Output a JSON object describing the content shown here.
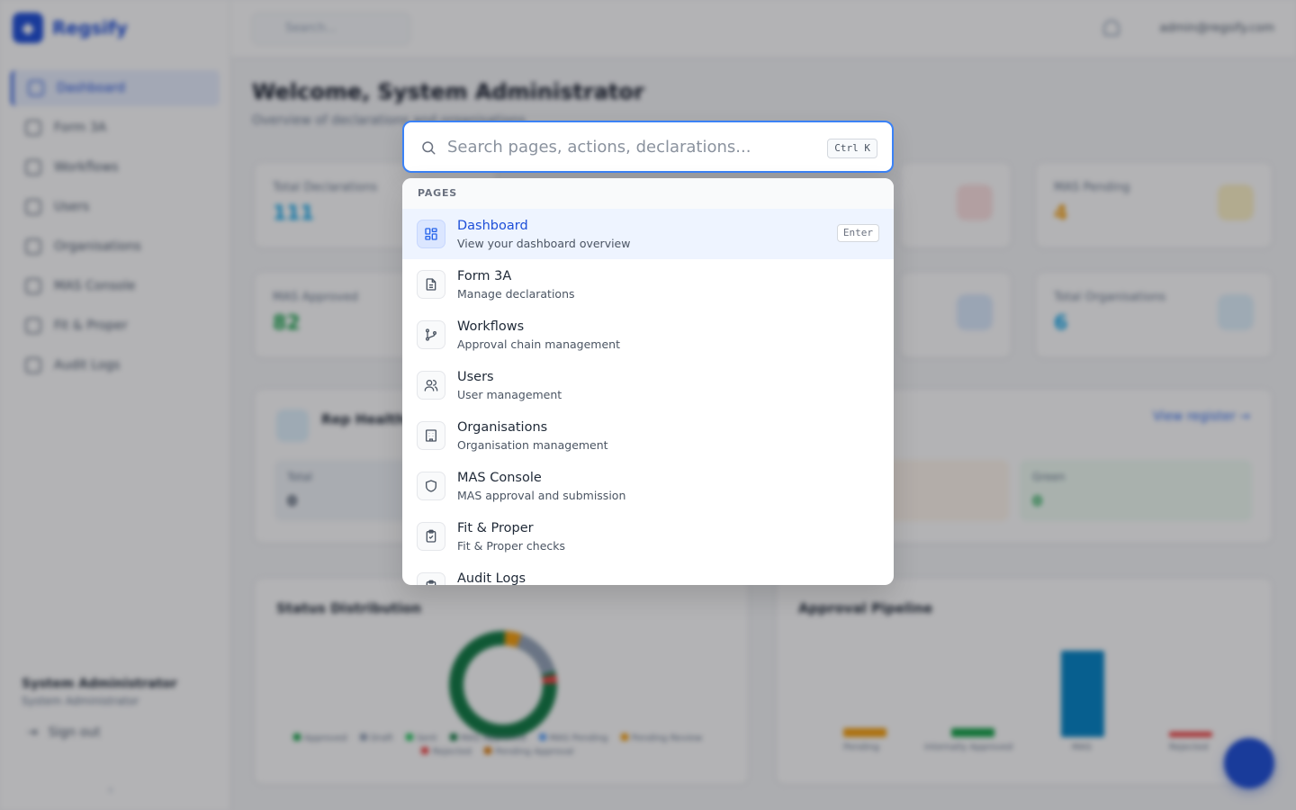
{
  "app": {
    "brand": "Regsify",
    "user_email": "admin@regsify.com",
    "top_search_placeholder": "Search...",
    "sidebar": {
      "items": [
        {
          "label": "Dashboard",
          "active": true
        },
        {
          "label": "Form 3A"
        },
        {
          "label": "Workflows"
        },
        {
          "label": "Users"
        },
        {
          "label": "Organisations"
        },
        {
          "label": "MAS Console"
        },
        {
          "label": "Fit & Proper"
        },
        {
          "label": "Audit Logs"
        }
      ],
      "user_name": "System Administrator",
      "user_role": "System Administrator",
      "sign_out": "Sign out"
    },
    "page_title": "Welcome, System Administrator",
    "page_subtitle": "Overview of declarations and organisations",
    "stats": [
      {
        "label": "Total Declarations",
        "value": "111",
        "color": "#0ea5e9"
      },
      {
        "label": "MAS Pending",
        "value": "4",
        "color": "#f59e0b"
      },
      {
        "label": "MAS Approved",
        "value": "82",
        "color": "#16a34a"
      },
      {
        "label": "Total Organisations",
        "value": "6",
        "color": "#0ea5e9"
      }
    ],
    "health": {
      "title": "Rep Health",
      "view_link": "View register →",
      "tiles": [
        {
          "label": "Total",
          "value": "0"
        },
        {
          "label": "Green",
          "value": "0"
        }
      ]
    },
    "status_chart": {
      "title": "Status Distribution",
      "legend": [
        "Approved",
        "Draft",
        "Sent",
        "MAS Approved",
        "MAS Pending",
        "Pending Review",
        "Rejected",
        "Pending Approval"
      ]
    },
    "pipeline_chart": {
      "title": "Approval Pipeline",
      "labels": [
        "Pending",
        "Internally Approved",
        "MAS",
        "Rejected"
      ]
    }
  },
  "palette": {
    "placeholder": "Search pages, actions, declarations...",
    "shortcut": "Ctrl K",
    "group_label": "PAGES",
    "enter_hint": "Enter",
    "items": [
      {
        "title": "Dashboard",
        "description": "View your dashboard overview",
        "icon": "dashboard-icon",
        "selected": true
      },
      {
        "title": "Form 3A",
        "description": "Manage declarations",
        "icon": "document-icon"
      },
      {
        "title": "Workflows",
        "description": "Approval chain management",
        "icon": "workflow-icon"
      },
      {
        "title": "Users",
        "description": "User management",
        "icon": "users-icon"
      },
      {
        "title": "Organisations",
        "description": "Organisation management",
        "icon": "building-icon"
      },
      {
        "title": "MAS Console",
        "description": "MAS approval and submission",
        "icon": "shield-icon"
      },
      {
        "title": "Fit & Proper",
        "description": "Fit & Proper checks",
        "icon": "clipboard-check-icon"
      },
      {
        "title": "Audit Logs",
        "description": "",
        "icon": "clipboard-icon"
      }
    ]
  }
}
